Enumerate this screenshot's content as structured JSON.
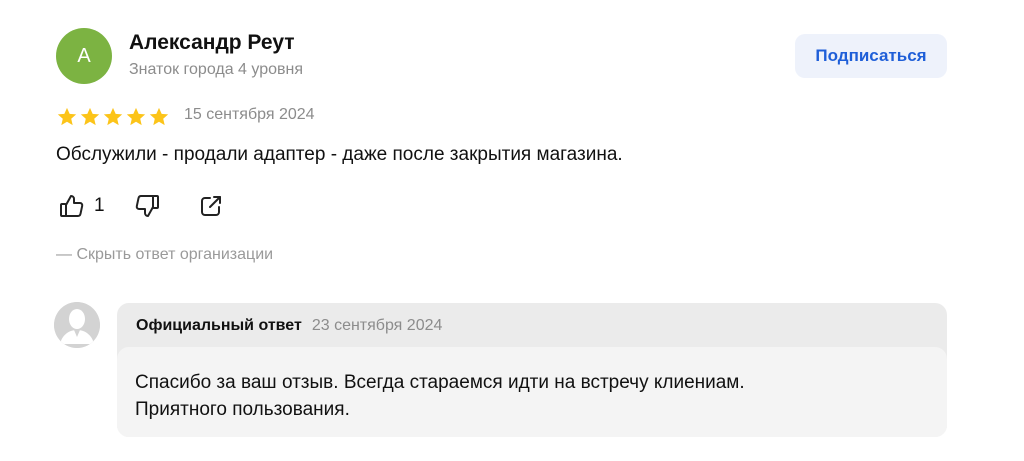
{
  "review": {
    "avatar_letter": "А",
    "author_name": "Александр Реут",
    "author_level": "Знаток города 4 уровня",
    "subscribe_label": "Подписаться",
    "rating": 5,
    "date": "15 сентября 2024",
    "text": "Обслужили - продали адаптер - даже после закрытия магазина.",
    "likes": "1",
    "hide_answer_label": "— Скрыть ответ организации"
  },
  "response": {
    "label": "Официальный ответ",
    "date": "23 сентября 2024",
    "lines": [
      "Спасибо за ваш отзыв. Всегда стараемся идти на встречу клиениам.",
      "Приятного пользования."
    ]
  },
  "colors": {
    "avatar_bg": "#7cb342",
    "star": "#fcc419",
    "accent_link": "#1f5fd8",
    "subscribe_bg": "#eef2fb"
  },
  "icons": {
    "like": "thumbs-up-icon",
    "dislike": "thumbs-down-icon",
    "share": "share-icon",
    "org_avatar": "user-silhouette-icon"
  }
}
